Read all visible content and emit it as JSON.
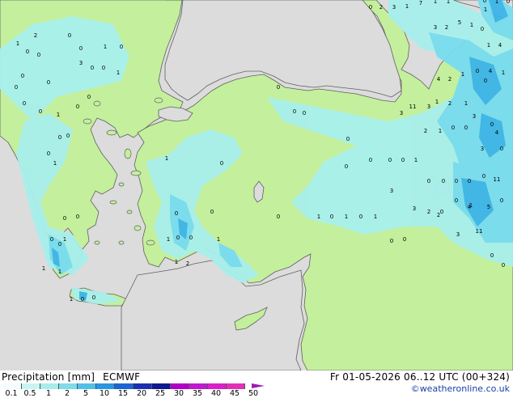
{
  "map": {
    "colors": {
      "sea": "#dcdcdc",
      "land": "#c4ef9c",
      "precip_light": "#a8f0ec",
      "precip_mid": "#78dcf0",
      "precip_heavy": "#3cb4e8",
      "coast": "#606060"
    },
    "value_labels": [
      "0",
      "2",
      "3",
      "1",
      "7",
      "1",
      "1",
      "0",
      "1",
      "0",
      "3",
      "2",
      "5",
      "1",
      "0",
      "1",
      "4",
      "4",
      "2",
      "1",
      "0",
      "4",
      "1",
      "0",
      "1",
      "2",
      "1",
      "0",
      "4",
      "3",
      "3",
      "11",
      "3",
      "2",
      "1",
      "0",
      "0",
      "3",
      "0",
      "11",
      "0",
      "0",
      "0",
      "0",
      "0",
      "1",
      "0",
      "0",
      "0",
      "0",
      "0",
      "3",
      "0",
      "4",
      "5",
      "0",
      "3",
      "2",
      "0",
      "1",
      "2",
      "3",
      "11",
      "0",
      "0",
      "1",
      "0",
      "1",
      "0",
      "1",
      "0",
      "0",
      "0",
      "0",
      "0",
      "0",
      "0",
      "1",
      "0",
      "1",
      "0",
      "0",
      "1",
      "2",
      "1",
      "0",
      "0",
      "0",
      "1",
      "0",
      "0",
      "0",
      "1",
      "0",
      "0",
      "1",
      "1",
      "1",
      "0",
      "0",
      "0",
      "0",
      "0",
      "0",
      "0",
      "0",
      "1",
      "3",
      "0",
      "2",
      "1",
      "0",
      "1",
      "0",
      "0",
      "0",
      "1",
      "0",
      "0",
      "0",
      "1"
    ]
  },
  "footer": {
    "title": "Precipitation [mm]",
    "model": "ECMWF",
    "date": "Fr 01-05-2026 06..12 UTC (00+324)",
    "credit": "©weatheronline.co.uk",
    "scale": {
      "labels": [
        "0.1",
        "0.5",
        "1",
        "2",
        "5",
        "10",
        "15",
        "20",
        "25",
        "30",
        "35",
        "40",
        "45",
        "50"
      ],
      "colors": [
        "#f4fcff",
        "#c8f4f4",
        "#a8ecec",
        "#80dce8",
        "#50c0e8",
        "#2896e0",
        "#1c64d4",
        "#1830b0",
        "#101890",
        "#b000c8",
        "#c018d0",
        "#d820c8",
        "#e030b8"
      ]
    }
  }
}
